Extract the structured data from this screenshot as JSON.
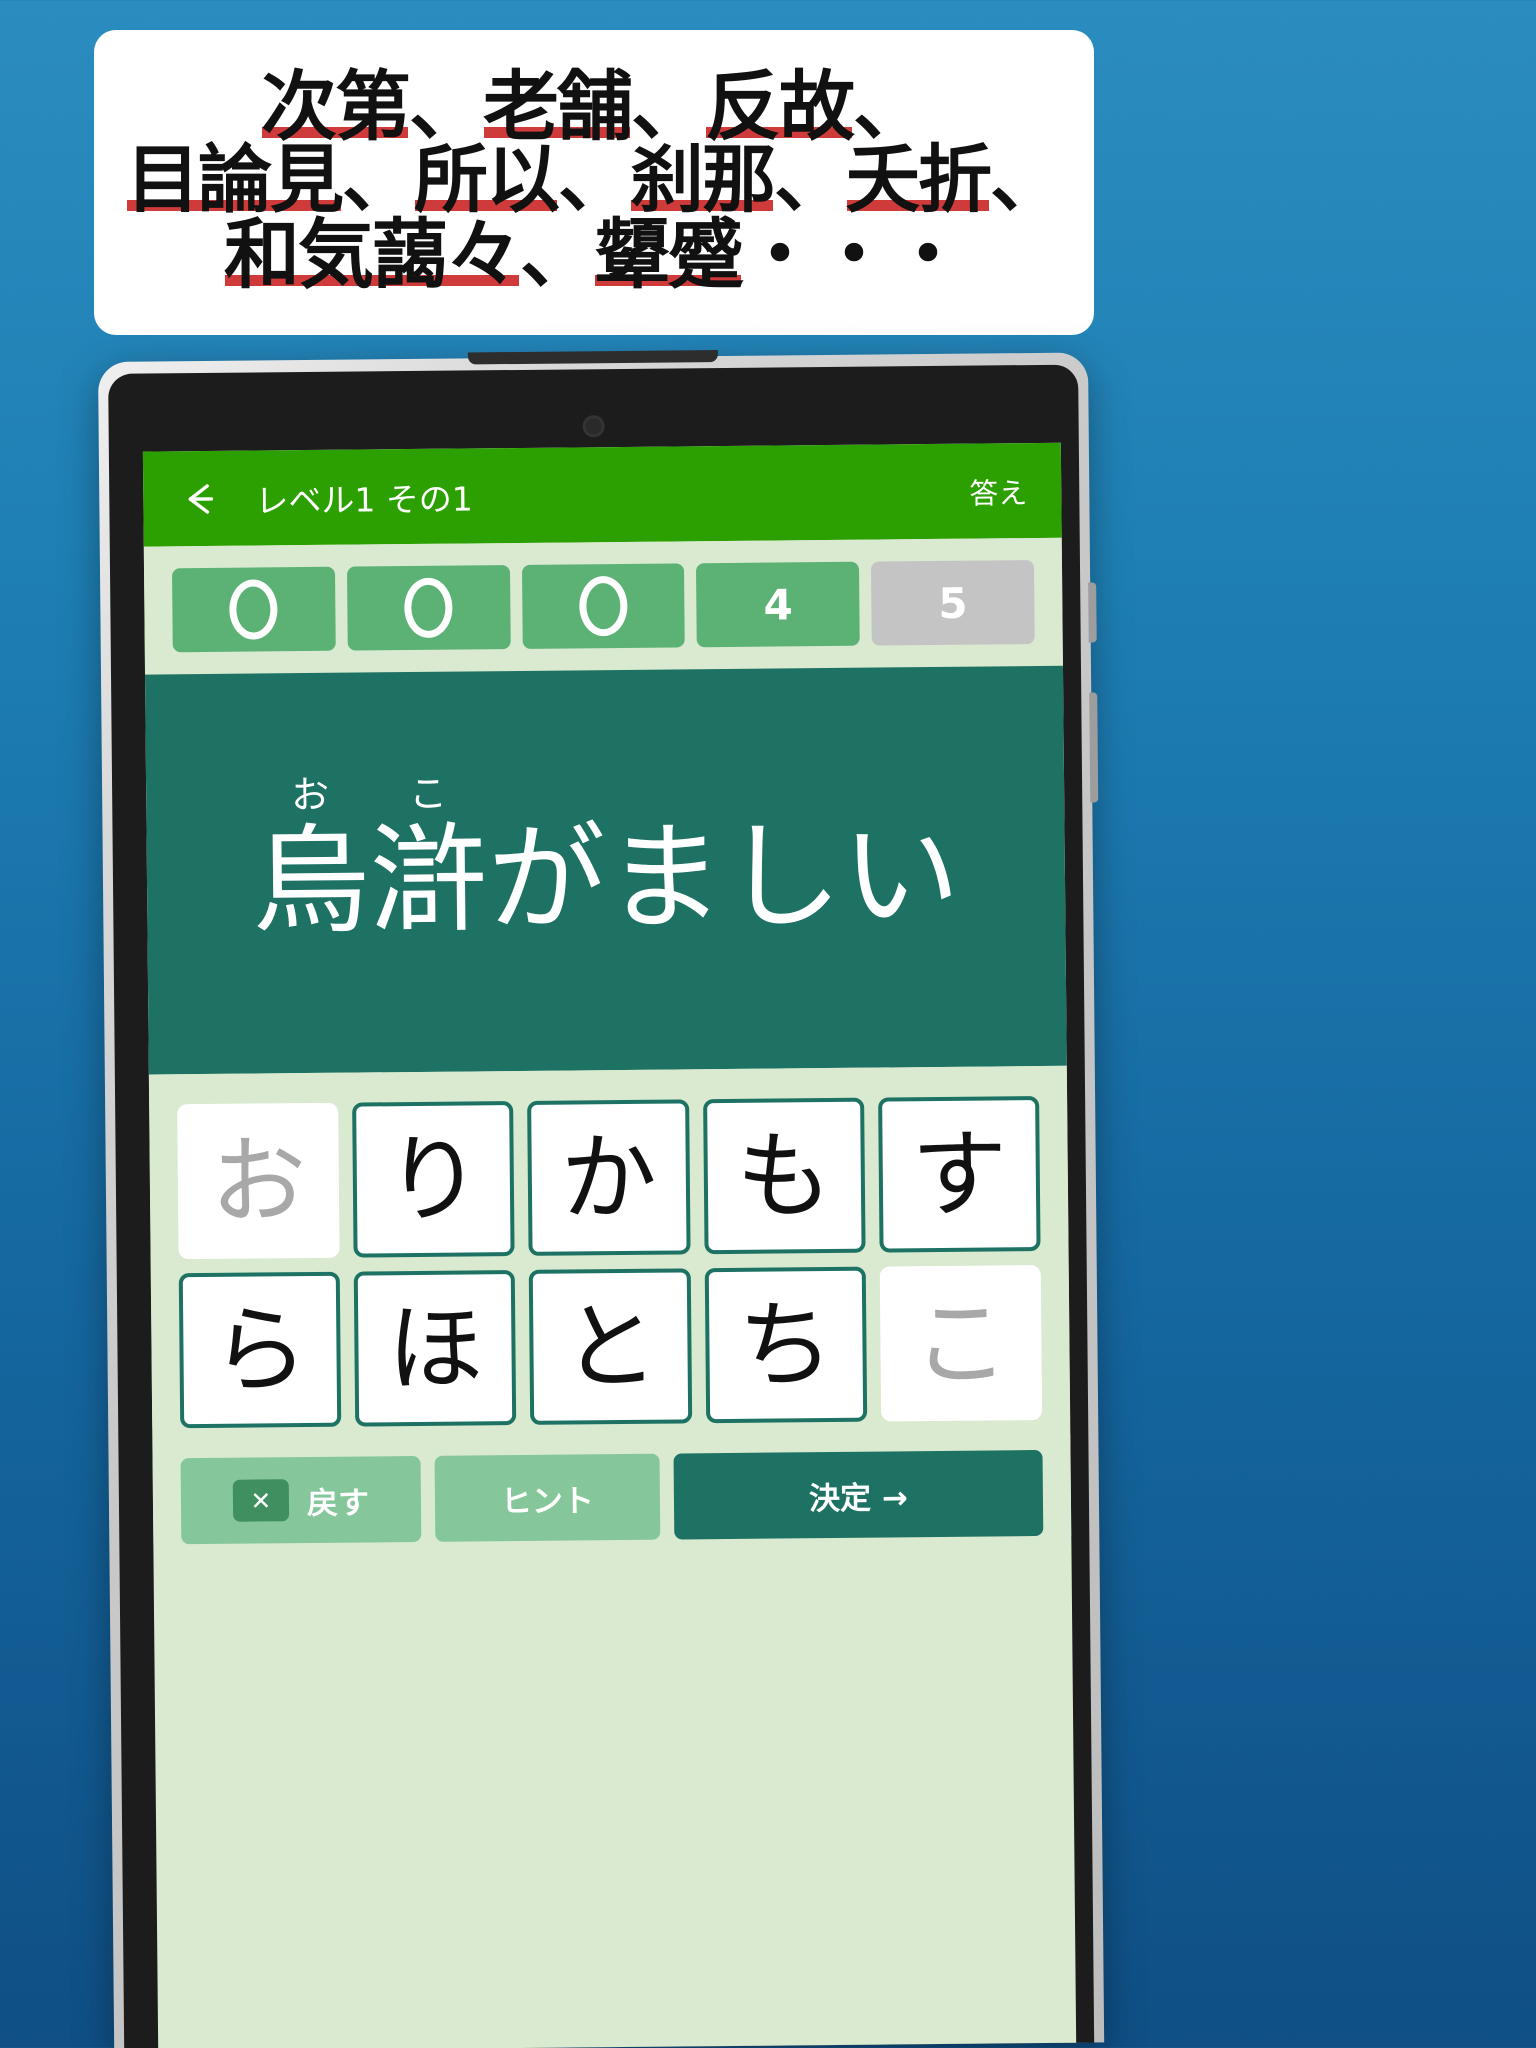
{
  "headline": {
    "lines": [
      {
        "segments": [
          {
            "text": "次第",
            "underline": true
          },
          {
            "text": "、",
            "underline": false
          },
          {
            "text": "老舗",
            "underline": true
          },
          {
            "text": "、",
            "underline": false
          },
          {
            "text": "反故",
            "underline": true
          },
          {
            "text": "、",
            "underline": false
          }
        ]
      },
      {
        "segments": [
          {
            "text": "目論見",
            "underline": true
          },
          {
            "text": "、",
            "underline": false
          },
          {
            "text": "所以",
            "underline": true
          },
          {
            "text": "、",
            "underline": false
          },
          {
            "text": "刹那",
            "underline": true
          },
          {
            "text": "、",
            "underline": false
          },
          {
            "text": "夭折",
            "underline": true
          },
          {
            "text": "、",
            "underline": false
          }
        ]
      },
      {
        "segments": [
          {
            "text": "和気藹々",
            "underline": true
          },
          {
            "text": "、",
            "underline": false
          },
          {
            "text": "顰蹙",
            "underline": true
          },
          {
            "text": "・・・",
            "underline": false
          }
        ]
      }
    ]
  },
  "colors": {
    "background_top": "#2b8cbf",
    "background_bottom": "#0f4f85",
    "appbar_green": "#2ba000",
    "panel_teal": "#1d7263",
    "chip_green": "#5cb275",
    "chip_grey": "#c4c4c4",
    "keyboard_bg": "#d9ead0",
    "underline_red": "#cf3b3b"
  },
  "appbar": {
    "back_icon": "arrow-left-icon",
    "title": "レベル1 その1",
    "answer_label": "答え"
  },
  "progress": {
    "chips": [
      {
        "label": "○",
        "state": "done"
      },
      {
        "label": "○",
        "state": "done"
      },
      {
        "label": "○",
        "state": "done"
      },
      {
        "label": "4",
        "state": "pending"
      },
      {
        "label": "5",
        "state": "current"
      }
    ]
  },
  "question": {
    "ruby_pairs": [
      {
        "reading": "お",
        "kanji": "烏"
      },
      {
        "reading": "こ",
        "kanji": "滸"
      }
    ],
    "tail": "がましい"
  },
  "keyboard": {
    "rows": [
      [
        {
          "char": "お",
          "used": true
        },
        {
          "char": "り",
          "used": false
        },
        {
          "char": "か",
          "used": false
        },
        {
          "char": "も",
          "used": false
        },
        {
          "char": "す",
          "used": false
        }
      ],
      [
        {
          "char": "ら",
          "used": false
        },
        {
          "char": "ほ",
          "used": false
        },
        {
          "char": "と",
          "used": false
        },
        {
          "char": "ち",
          "used": false
        },
        {
          "char": "こ",
          "used": true
        }
      ]
    ]
  },
  "actions": {
    "back_label": "戻す",
    "back_icon": "backspace-icon",
    "hint_label": "ヒント",
    "enter_label": "決定 →"
  }
}
